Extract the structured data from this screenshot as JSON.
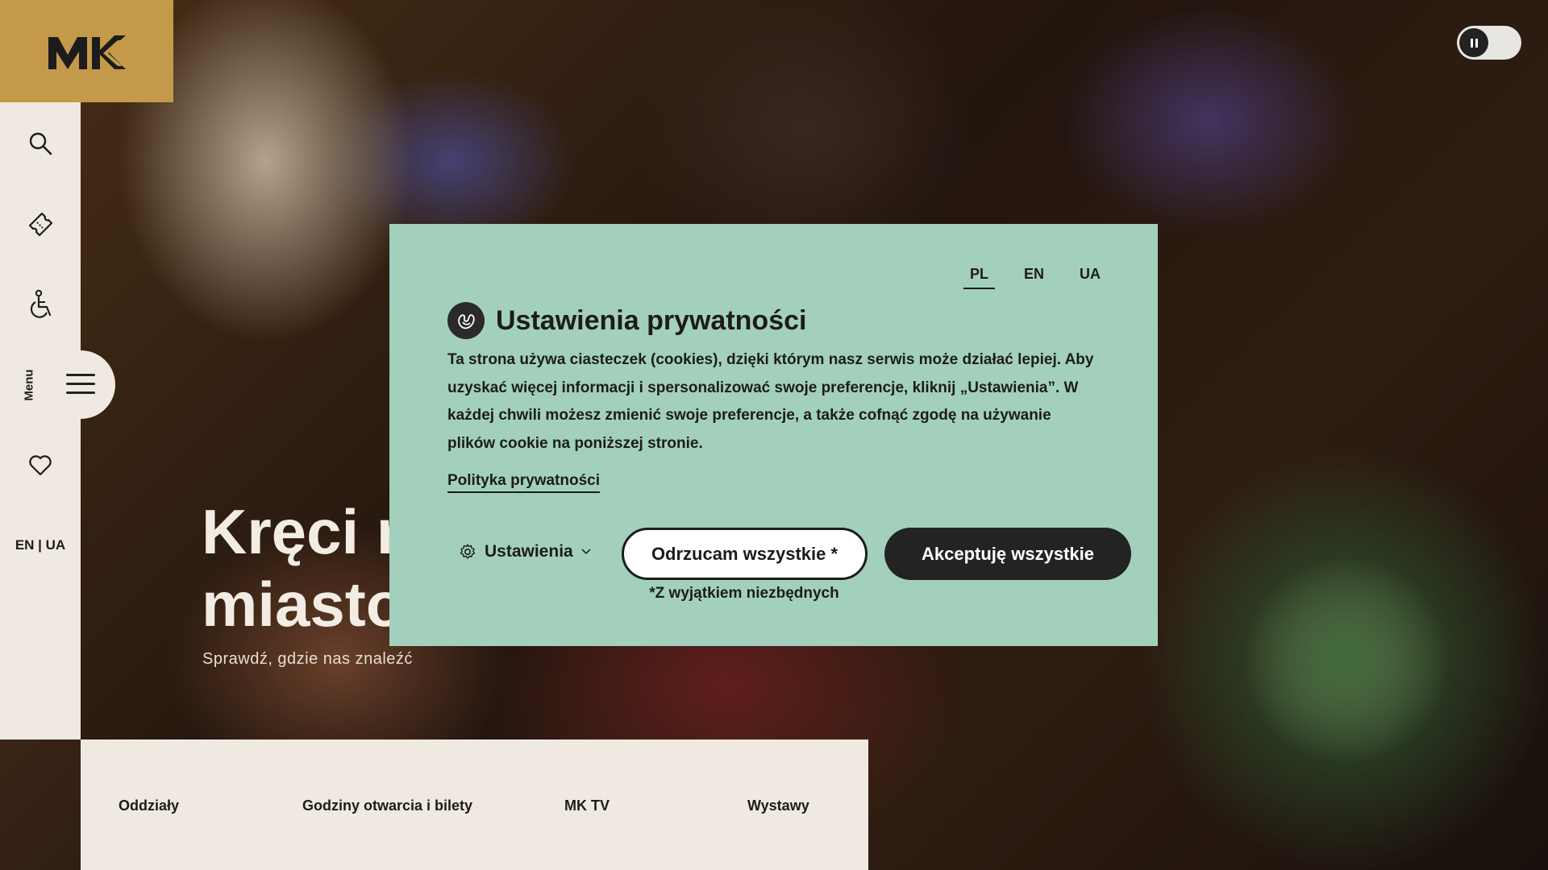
{
  "colors": {
    "rail_bg": "#efe9e1",
    "logo_bg": "#c49a4a",
    "modal_bg": "#a3d0bd",
    "primary_dark": "#232323"
  },
  "logo": {
    "text": "MK",
    "icon": "mk-logo"
  },
  "rail": {
    "icons": [
      "search-icon",
      "ticket-icon",
      "accessibility-icon",
      "heart-icon"
    ],
    "menu_label": "Menu",
    "languages": "EN | UA"
  },
  "hero": {
    "title_line1": "Kręci n",
    "title_line2": "miasto",
    "subtitle": "Sprawdź, gdzie nas znaleźć"
  },
  "bottom_nav": {
    "items": [
      {
        "label": "Oddziały"
      },
      {
        "label": "Godziny otwarcia i bilety"
      },
      {
        "label": "MK TV"
      },
      {
        "label": "Wystawy"
      }
    ]
  },
  "privacy_modal": {
    "languages": [
      {
        "code": "PL",
        "active": true
      },
      {
        "code": "EN",
        "active": false
      },
      {
        "code": "UA",
        "active": false
      }
    ],
    "title": "Ustawienia prywatności",
    "body": "Ta strona używa ciasteczek (cookies), dzięki którym nasz serwis może działać lepiej. Aby uzyskać więcej informacji i spersonalizować swoje preferencje, kliknij „Ustawienia”. W każdej chwili możesz zmienić swoje preferencje, a także cofnąć zgodę na używanie plików cookie na poniższej stronie.",
    "policy_link": "Polityka prywatności",
    "settings_label": "Ustawienia",
    "reject_label": "Odrzucam wszystkie  *",
    "reject_note": "*Z wyjątkiem niezbędnych",
    "accept_label": "Akceptuję wszystkie"
  }
}
